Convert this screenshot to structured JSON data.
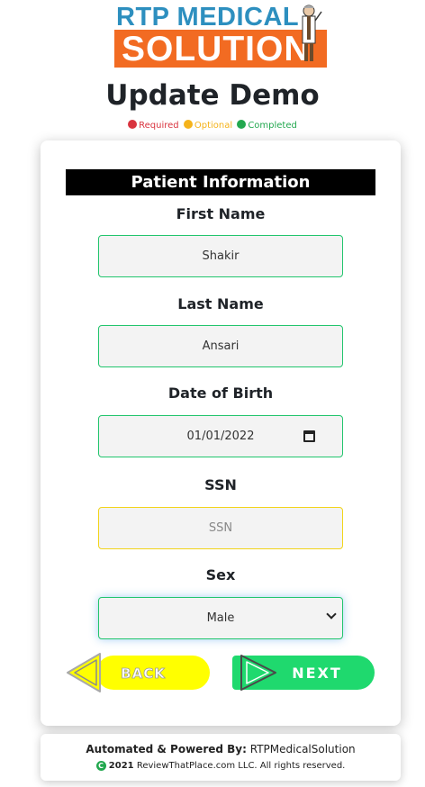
{
  "brand": {
    "line1": "RTP MEDICAL",
    "line2": "SOLUTION",
    "colors": {
      "blue": "#2d8fbf",
      "orange": "#f26b22"
    }
  },
  "page": {
    "title": "Update Demo"
  },
  "legend": [
    {
      "label": "Required",
      "color": "#d9343f"
    },
    {
      "label": "Optional",
      "color": "#f5b31b"
    },
    {
      "label": "Completed",
      "color": "#22a84f"
    }
  ],
  "form": {
    "section_title": "Patient Information",
    "fields": {
      "first_name": {
        "label": "First Name",
        "value": "Shakir"
      },
      "last_name": {
        "label": "Last Name",
        "value": "Ansari"
      },
      "dob": {
        "label": "Date of Birth",
        "value": "01/01/2022"
      },
      "ssn": {
        "label": "SSN",
        "placeholder": "SSN"
      },
      "sex": {
        "label": "Sex",
        "value": "Male"
      }
    }
  },
  "buttons": {
    "back": {
      "label": "BACK",
      "color": "#ffff00"
    },
    "next": {
      "label": "NEXT",
      "color": "#1fd96e"
    }
  },
  "footer": {
    "powered_prefix": "Automated & Powered By:",
    "powered_name": "RTPMedicalSolution",
    "year": "2021",
    "copyright_rest": "ReviewThatPlace.com LLC. All rights reserved."
  }
}
